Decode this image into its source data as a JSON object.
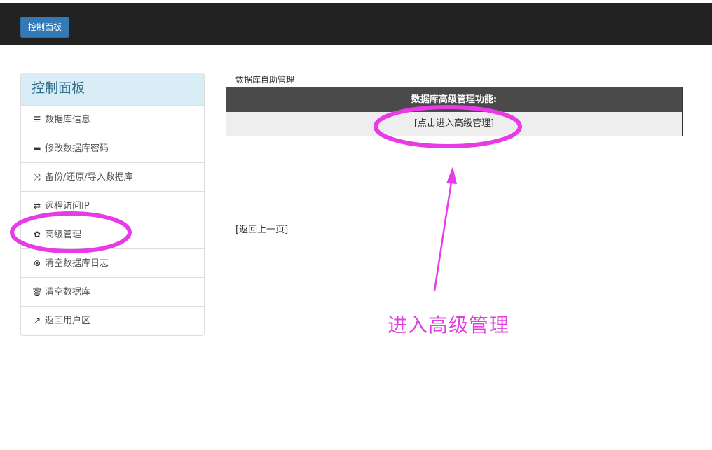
{
  "navbar": {
    "brand_label": "控制面板"
  },
  "sidebar": {
    "heading": "控制面板",
    "items": [
      {
        "label": "数据库信息",
        "icon": "list-icon",
        "glyph": "☰"
      },
      {
        "label": "修改数据库密码",
        "icon": "hdd-icon",
        "glyph": "▬"
      },
      {
        "label": "备份/还原/导入数据库",
        "icon": "shuffle-icon",
        "glyph": "⤨"
      },
      {
        "label": "远程访问IP",
        "icon": "transfer-icon",
        "glyph": "⇄"
      },
      {
        "label": "高级管理",
        "icon": "cog-icon",
        "glyph": "✿"
      },
      {
        "label": "清空数据库日志",
        "icon": "remove-circle-icon",
        "glyph": "⊗"
      },
      {
        "label": "清空数据库",
        "icon": "trash-icon",
        "glyph": "🗑"
      },
      {
        "label": "返回用户区",
        "icon": "share-icon",
        "glyph": "↗"
      }
    ]
  },
  "main": {
    "title": "数据库自助管理",
    "table_header": "数据库高级管理功能:",
    "advanced_link": "[点击进入高级管理]",
    "back_link": "[返回上一页]"
  },
  "annotation": {
    "text": "进入高级管理",
    "color": "#e040e0"
  }
}
